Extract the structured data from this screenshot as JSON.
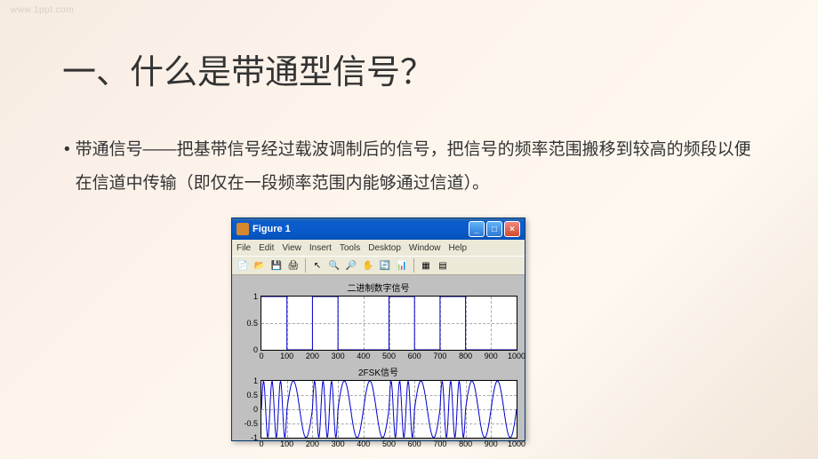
{
  "watermark": "www.1ppt.com",
  "title": "一、什么是带通型信号？",
  "content": {
    "bullet_marker": "•",
    "text": "带通信号——把基带信号经过载波调制后的信号，把信号的频率范围搬移到较高的频段以便在信道中传输（即仅在一段频率范围内能够通过信道）。"
  },
  "figure_window": {
    "title": "Figure 1",
    "menus": [
      "File",
      "Edit",
      "View",
      "Insert",
      "Tools",
      "Desktop",
      "Window",
      "Help"
    ],
    "win_buttons": {
      "min": "_",
      "max": "□",
      "close": "×"
    }
  },
  "chart_data": [
    {
      "type": "line",
      "title": "二进制数字信号",
      "xlim": [
        0,
        1000
      ],
      "ylim": [
        0,
        1
      ],
      "xticks": [
        0,
        100,
        200,
        300,
        400,
        500,
        600,
        700,
        800,
        900,
        1000
      ],
      "yticks": [
        0,
        0.5,
        1
      ],
      "x": [
        0,
        100,
        100,
        200,
        200,
        300,
        300,
        500,
        500,
        600,
        600,
        700,
        700,
        800,
        800,
        1000
      ],
      "values": [
        1,
        1,
        0,
        0,
        1,
        1,
        0,
        0,
        1,
        1,
        0,
        0,
        1,
        1,
        0,
        0
      ],
      "bits": [
        1,
        0,
        1,
        0,
        0,
        1,
        0,
        1,
        0,
        0
      ]
    },
    {
      "type": "line",
      "title": "2FSK信号",
      "xlim": [
        0,
        1000
      ],
      "ylim": [
        -1,
        1
      ],
      "xticks": [
        0,
        100,
        200,
        300,
        400,
        500,
        600,
        700,
        800,
        900,
        1000
      ],
      "yticks": [
        -1,
        -0.5,
        0,
        0.5,
        1
      ],
      "bits": [
        1,
        0,
        1,
        0,
        0,
        1,
        0,
        1,
        0,
        0
      ],
      "freq_high_cycles_per_bit": 3,
      "freq_low_cycles_per_bit": 1
    }
  ]
}
